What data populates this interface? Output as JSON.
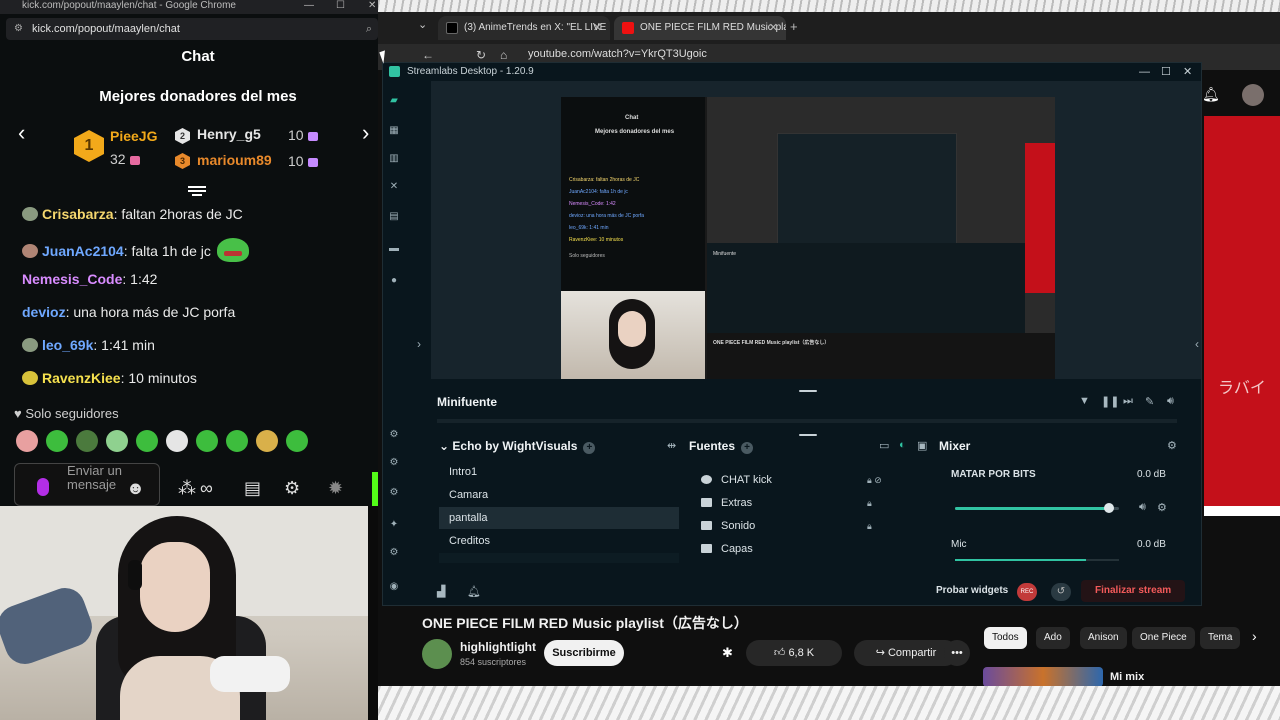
{
  "kick": {
    "window_title": "kick.com/popout/maaylen/chat - Google Chrome",
    "url": "kick.com/popout/maaylen/chat",
    "chat_title": "Chat",
    "donors_title": "Mejores donadores del mes",
    "donors": [
      {
        "rank": "1",
        "name": "PieeJG",
        "amount": "32",
        "color": "#f2a91a"
      },
      {
        "rank": "2",
        "name": "Henry_g5",
        "amount": "10",
        "color": "#e6e6e6"
      },
      {
        "rank": "3",
        "name": "marioum89",
        "amount": "10",
        "color": "#e8892b"
      }
    ],
    "messages": [
      {
        "user": "Crisabarza",
        "text": ": faltan 2horas de JC",
        "color": "#f5d76e"
      },
      {
        "user": "JuanAc2104",
        "text": ": falta 1h de jc",
        "color": "#6fa8ff"
      },
      {
        "user": "Nemesis_Code",
        "text": ": 1:42",
        "color": "#d98cff"
      },
      {
        "user": "devioz",
        "text": ": una hora más de JC porfa",
        "color": "#6fa8ff"
      },
      {
        "user": "leo_69k",
        "text": ": 1:41 min",
        "color": "#6fa8ff"
      },
      {
        "user": "RavenzKiee",
        "text": ": 10 minutos",
        "color": "#f5e04e"
      }
    ],
    "followers_only": "Solo seguidores",
    "send_placeholder": "Enviar un mensaje"
  },
  "chrome": {
    "tabs": [
      {
        "title": "(3) AnimeTrends en X: \"EL LIVE",
        "icon": "x-icon"
      },
      {
        "title": "ONE PIECE FILM RED Music pla",
        "icon": "youtube-icon"
      }
    ],
    "url": "youtube.com/watch?v=YkrQT3Ugoic",
    "video_title": "ONE PIECE FILM RED Music playlist（広告なし）",
    "channel": "highlightlight",
    "subs": "854 suscriptores",
    "subscribe": "Suscribirme",
    "likes": "6,8 K",
    "share": "Compartir",
    "chips": [
      "Todos",
      "Ado",
      "Anison",
      "One Piece",
      "Tema"
    ],
    "mix": "Mi mix",
    "banner_text": "ラバイ"
  },
  "streamlabs": {
    "title": "Streamlabs Desktop - 1.20.9",
    "minifuente": "Minifuente",
    "scenes_header": "Echo by WightVisuals",
    "scenes": [
      "Intro1",
      "Camara",
      "pantalla",
      "Creditos"
    ],
    "selected_scene": "pantalla",
    "sources_header": "Fuentes",
    "sources": [
      "CHAT kick",
      "Extras",
      "Sonido",
      "Capas"
    ],
    "mixer_header": "Mixer",
    "mixer": [
      {
        "name": "MATAR POR BITS",
        "db": "0.0 dB",
        "level": 0.94
      },
      {
        "name": "Mic",
        "db": "0.0 dB",
        "level": 0.8
      }
    ],
    "probar": "Probar widgets",
    "rec": "REC",
    "finalizar": "Finalizar stream",
    "preview": {
      "chat_title": "Chat",
      "donors_title": "Mejores donadores del mes",
      "lines": [
        "Crisabarza: faltan 2horas de JC",
        "JuanAc2104: falta 1h de jc",
        "Nemesis_Code: 1:42",
        "devioz: una hora más de JC porfa",
        "leo_69k: 1:41 min",
        "RavenzKiee: 10 minutos"
      ],
      "solo": "Solo seguidores",
      "minifuente": "Minifuente",
      "yt_title": "ONE PIECE FILM RED Music playlist（広告なし）"
    }
  }
}
